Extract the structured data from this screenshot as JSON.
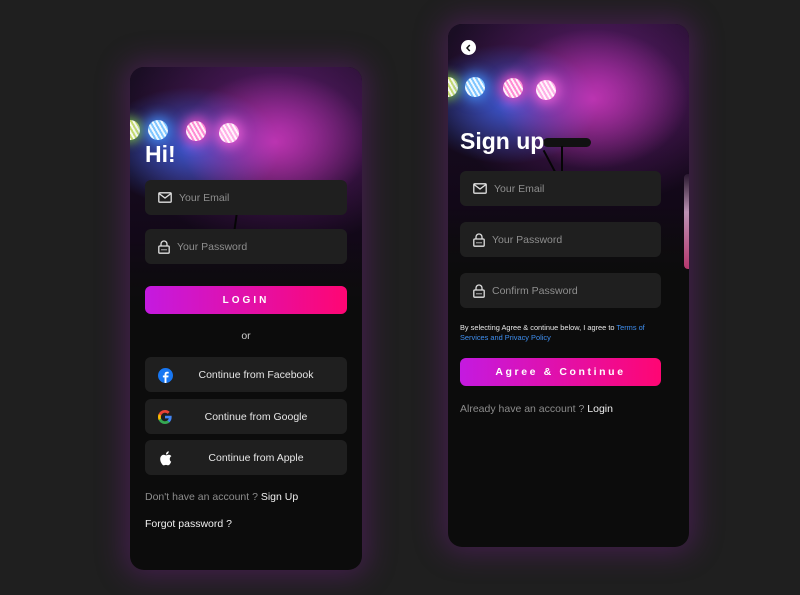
{
  "login": {
    "title": "Hi!",
    "email_placeholder": "Your Email",
    "password_placeholder": "Your Password",
    "login_label": "LOGIN",
    "or_label": "or",
    "social_buttons": [
      {
        "icon": "facebook-icon",
        "label": "Continue from Facebook"
      },
      {
        "icon": "google-icon",
        "label": "Continue from Google"
      },
      {
        "icon": "apple-icon",
        "label": "Continue from Apple"
      }
    ],
    "no_account_text": "Don't have an account ?",
    "sign_up_link": "Sign Up",
    "forgot_password": "Forgot password ?"
  },
  "signup": {
    "back_icon": "chevron-left-icon",
    "title": "Sign up",
    "email_placeholder": "Your Email",
    "password_placeholder": "Your Password",
    "confirm_placeholder": "Confirm Password",
    "terms_text": "By selecting Agree & continue below, I agree to",
    "terms_link": "Terms of Services and Privacy Policy",
    "agree_label": "Agree & Continue",
    "have_account_text": "Already have an account ?",
    "login_link": "Login"
  },
  "colors": {
    "background": "#1f1f1f",
    "card": "#0c0c0c",
    "field": "#1f1f1f",
    "gradient_start": "#c41ae0",
    "gradient_end": "#ff0673",
    "link_blue": "#3f8ff0",
    "facebook_blue": "#1877f2"
  }
}
